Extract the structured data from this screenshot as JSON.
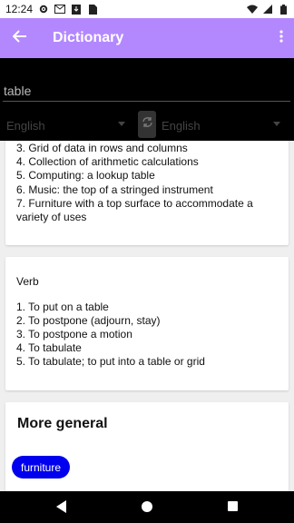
{
  "status_bar": {
    "time": "12:24",
    "left_icons": [
      "settings-icon",
      "gmail-icon",
      "download-icon",
      "sim-icon"
    ],
    "right_icons": [
      "wifi-icon",
      "signal-icon",
      "battery-icon"
    ]
  },
  "app_bar": {
    "title": "Dictionary",
    "back_icon": "arrow-left-icon",
    "menu_icon": "more-vert-icon",
    "color": "#b388ff"
  },
  "search": {
    "value": "table",
    "source_language": "English",
    "target_language": "English",
    "swap_icon": "swap-icon"
  },
  "noun_card": {
    "definitions": [
      "3. Grid of data in rows and columns",
      "4. Collection of arithmetic calculations",
      "5. Computing: a lookup table",
      "6. Music: the top of a stringed instrument",
      "7. Furniture with a top surface to accommodate a variety of uses"
    ]
  },
  "verb_card": {
    "part_of_speech": "Verb",
    "definitions": [
      "1. To put on a table",
      "2. To postpone (adjourn, stay)",
      "3. To postpone a motion",
      "4. To tabulate",
      "5. To tabulate; to put into a table or grid"
    ]
  },
  "more_general": {
    "title": "More general",
    "chips": [
      "furniture"
    ],
    "chip_color": "#0000ee"
  },
  "nav_bar": {
    "icons": [
      "back-nav-icon",
      "home-nav-icon",
      "recents-nav-icon"
    ]
  }
}
